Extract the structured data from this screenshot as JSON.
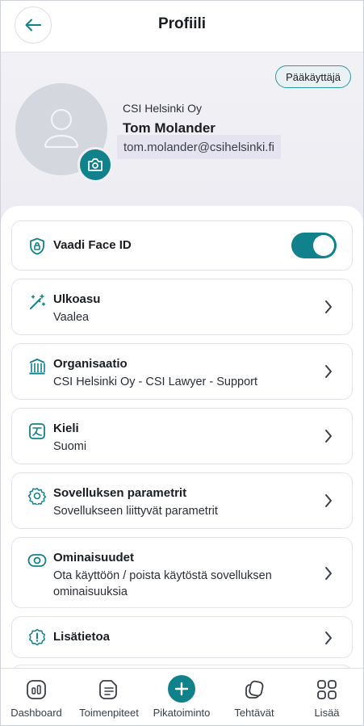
{
  "header": {
    "title": "Profiili"
  },
  "profile": {
    "role_badge": "Pääkäyttäjä",
    "company": "CSI Helsinki Oy",
    "name": "Tom Molander",
    "email": "tom.molander@csihelsinki.fi"
  },
  "settings": {
    "face_id": {
      "label": "Vaadi Face ID",
      "enabled": true
    },
    "items": [
      {
        "title": "Ulkoasu",
        "subtitle": "Vaalea",
        "icon": "magic-wand-icon"
      },
      {
        "title": "Organisaatio",
        "subtitle": "CSI Helsinki Oy - CSI Lawyer - Support",
        "icon": "building-icon"
      },
      {
        "title": "Kieli",
        "subtitle": "Suomi",
        "icon": "language-icon"
      },
      {
        "title": "Sovelluksen parametrit",
        "subtitle": "Sovellukseen liittyvät parametrit",
        "icon": "gear-icon"
      },
      {
        "title": "Ominaisuudet",
        "subtitle": "Ota käyttöön / poista käytöstä sovelluksen ominaisuuksia",
        "icon": "eye-icon"
      },
      {
        "title": "Lisätietoa",
        "subtitle": "",
        "icon": "info-badge-icon"
      }
    ]
  },
  "nav": [
    {
      "label": "Dashboard",
      "icon": "dashboard-icon"
    },
    {
      "label": "Toimenpiteet",
      "icon": "document-icon"
    },
    {
      "label": "Pikatoiminto",
      "icon": "plus-icon"
    },
    {
      "label": "Tehtävät",
      "icon": "tasks-icon"
    },
    {
      "label": "Lisää",
      "icon": "grid-icon"
    }
  ],
  "colors": {
    "accent": "#11828c",
    "text": "#1a1d23",
    "card_border": "#e3e5ea"
  }
}
